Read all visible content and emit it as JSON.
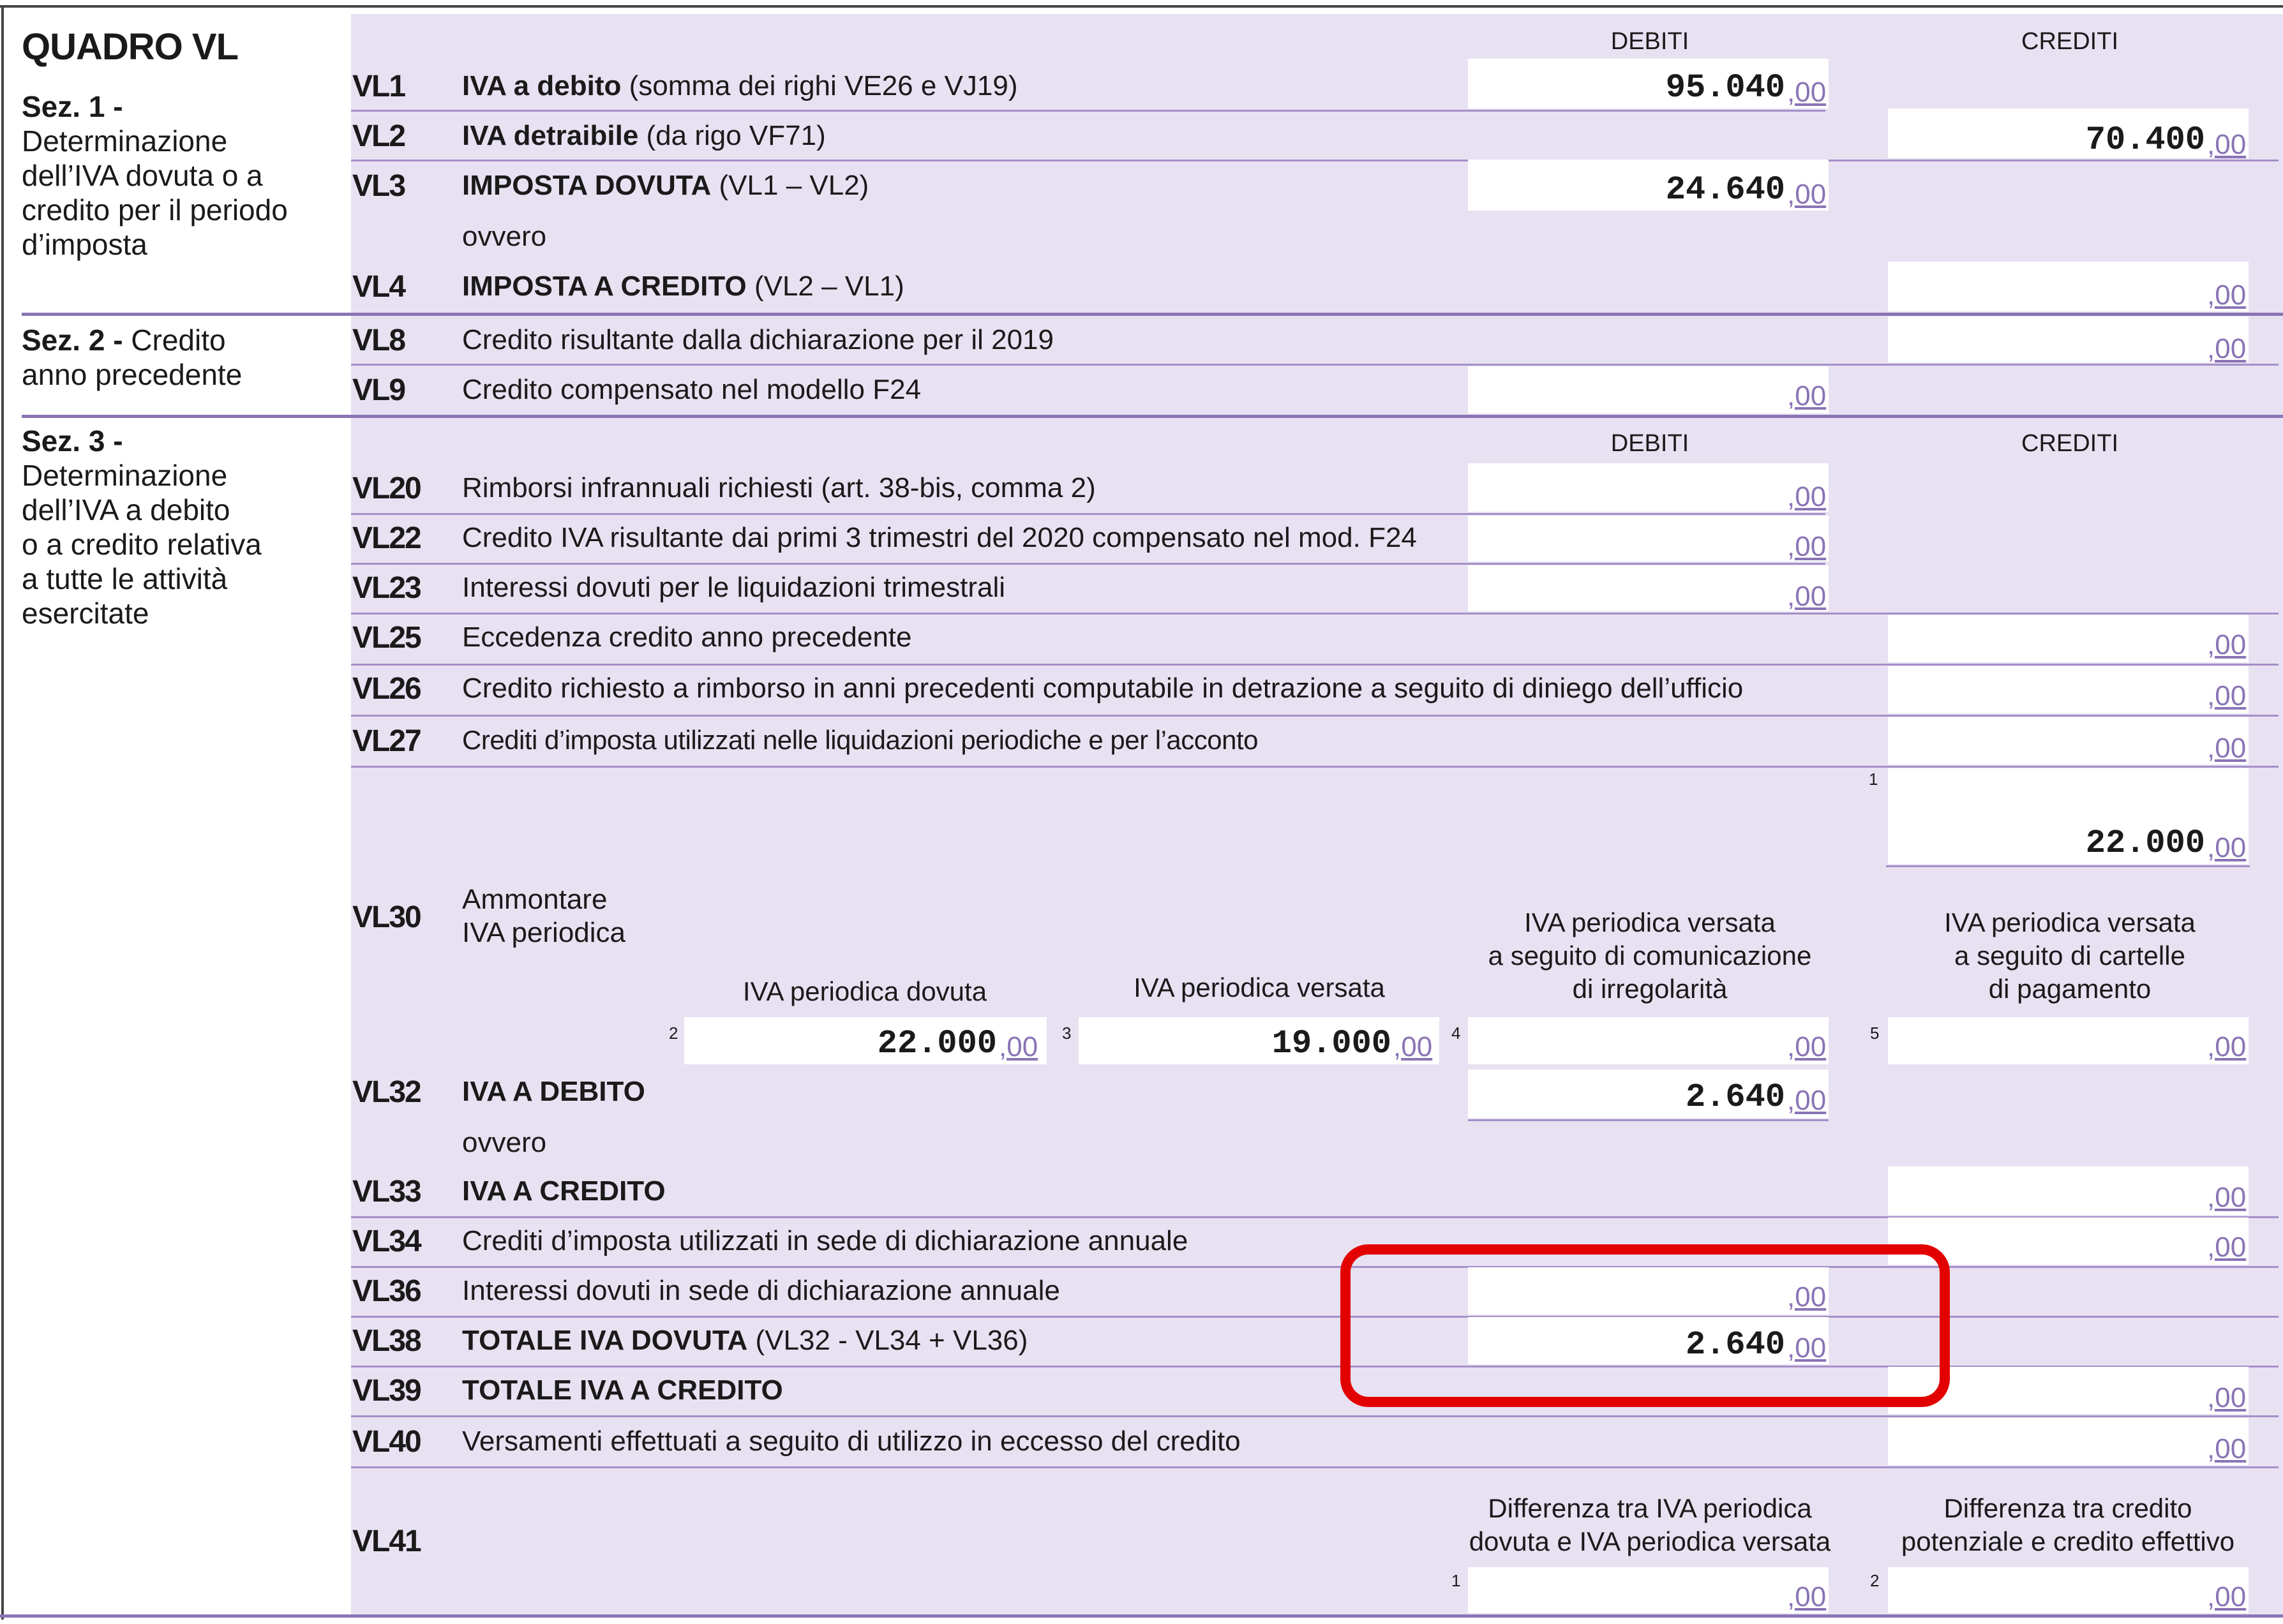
{
  "title": "QUADRO VL",
  "columns": {
    "debiti": "DEBITI",
    "crediti": "CREDITI"
  },
  "sections": {
    "s1": {
      "label": "Sez. 1 -",
      "text": [
        "Determinazione",
        "dell’IVA dovuta o a",
        "credito per il periodo",
        "d’imposta"
      ]
    },
    "s2": {
      "label": "Sez. 2 -",
      "label_rest": " Credito",
      "text": [
        "anno precedente"
      ]
    },
    "s3": {
      "label": "Sez. 3 -",
      "text": [
        "Determinazione",
        "dell’IVA a debito",
        "o a credito relativa",
        "a tutte le attività",
        "esercitate"
      ]
    }
  },
  "decimals": ",00",
  "ovvero": "ovvero",
  "rows": {
    "VL1": {
      "code": "VL1",
      "bold": "IVA a debito",
      "rest": " (somma dei righi VE26 e VJ19)",
      "debiti": "95.040"
    },
    "VL2": {
      "code": "VL2",
      "bold": "IVA detraibile",
      "rest": " (da rigo VF71)",
      "crediti": "70.400"
    },
    "VL3": {
      "code": "VL3",
      "bold": "IMPOSTA DOVUTA",
      "rest": " (VL1 –  VL2)",
      "debiti": "24.640"
    },
    "VL4": {
      "code": "VL4",
      "bold": "IMPOSTA A CREDITO",
      "rest": " (VL2 – VL1)"
    },
    "VL8": {
      "code": "VL8",
      "rest": "Credito risultante dalla dichiarazione per il 2019"
    },
    "VL9": {
      "code": "VL9",
      "rest": "Credito compensato nel modello F24"
    },
    "VL20": {
      "code": "VL20",
      "rest": "Rimborsi infrannuali richiesti (art. 38-bis, comma 2)"
    },
    "VL22": {
      "code": "VL22",
      "rest": "Credito IVA risultante dai primi 3 trimestri del 2020 compensato nel mod. F24"
    },
    "VL23": {
      "code": "VL23",
      "rest": "Interessi dovuti per le liquidazioni trimestrali"
    },
    "VL25": {
      "code": "VL25",
      "rest": "Eccedenza credito anno precedente"
    },
    "VL26": {
      "code": "VL26",
      "rest": "Credito richiesto a rimborso in anni precedenti computabile in detrazione a seguito di diniego dell’ufficio"
    },
    "VL27": {
      "code": "VL27",
      "rest": "Crediti d’imposta utilizzati nelle liquidazioni periodiche e per l’acconto"
    },
    "VL30": {
      "code": "VL30",
      "label": [
        "Ammontare",
        "IVA periodica"
      ],
      "f1": "22.000",
      "f2_label": "IVA periodica dovuta",
      "f2": "22.000",
      "f3_label": "IVA periodica versata",
      "f3": "19.000",
      "f4_label": [
        "IVA periodica versata",
        "a seguito di comunicazione",
        "di irregolarità"
      ],
      "f5_label": [
        "IVA periodica versata",
        "a seguito di cartelle",
        "di pagamento"
      ],
      "n1": "1",
      "n2": "2",
      "n3": "3",
      "n4": "4",
      "n5": "5"
    },
    "VL32": {
      "code": "VL32",
      "bold": "IVA A DEBITO",
      "debiti": "2.640"
    },
    "VL33": {
      "code": "VL33",
      "bold": "IVA A CREDITO"
    },
    "VL34": {
      "code": "VL34",
      "rest": "Crediti d’imposta utilizzati in sede di dichiarazione annuale"
    },
    "VL36": {
      "code": "VL36",
      "rest": "Interessi dovuti in sede di dichiarazione annuale"
    },
    "VL38": {
      "code": "VL38",
      "bold": "TOTALE IVA DOVUTA",
      "rest": " (VL32 - VL34 + VL36)",
      "debiti": "2.640"
    },
    "VL39": {
      "code": "VL39",
      "bold": "TOTALE IVA A CREDITO"
    },
    "VL40": {
      "code": "VL40",
      "rest": "Versamenti effettuati a seguito di utilizzo in eccesso del credito"
    },
    "VL41": {
      "code": "VL41",
      "c1_label": [
        "Differenza tra IVA periodica",
        "dovuta e IVA periodica versata"
      ],
      "c2_label": [
        "Differenza tra credito",
        "potenziale e credito effettivo"
      ],
      "n1": "1",
      "n2": "2"
    }
  },
  "colors": {
    "band": "#e8e1f2",
    "rule": "#8a74b5",
    "highlight": "#e20000"
  }
}
